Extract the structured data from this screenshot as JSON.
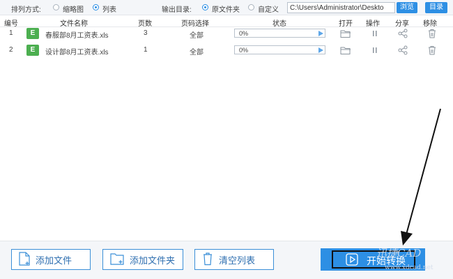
{
  "toolbar": {
    "sort_label": "排列方式:",
    "sort_options": [
      {
        "label": "缩略图",
        "selected": false
      },
      {
        "label": "列表",
        "selected": true
      }
    ],
    "output_label": "输出目录:",
    "output_options": [
      {
        "label": "原文件夹",
        "selected": true
      },
      {
        "label": "自定义",
        "selected": false
      }
    ],
    "output_path": "C:\\Users\\Administrator\\Deskto",
    "browse_label": "浏览",
    "dir_label": "目录"
  },
  "table": {
    "headers": [
      "编号",
      "文件名称",
      "页数",
      "页码选择",
      "状态",
      "打开",
      "操作",
      "分享",
      "移除"
    ],
    "rows": [
      {
        "num": "1",
        "type_badge": "E",
        "name": "春服部8月工资表.xls",
        "pages": "3",
        "page_select": "全部",
        "progress_text": "0%",
        "progress": 0
      },
      {
        "num": "2",
        "type_badge": "E",
        "name": "设计部8月工资表.xls",
        "pages": "1",
        "page_select": "全部",
        "progress_text": "0%",
        "progress": 0
      }
    ]
  },
  "bottom": {
    "add_file": "添加文件",
    "add_folder": "添加文件夹",
    "clear_list": "清空列表",
    "start": "开始转换"
  },
  "watermark": {
    "line1": "迅捷CAD",
    "line2": "www.xdcad.net"
  },
  "colors": {
    "accent": "#2d8fe4",
    "excel": "#4caf50",
    "toolbar_bg": "#f4f6f9"
  }
}
